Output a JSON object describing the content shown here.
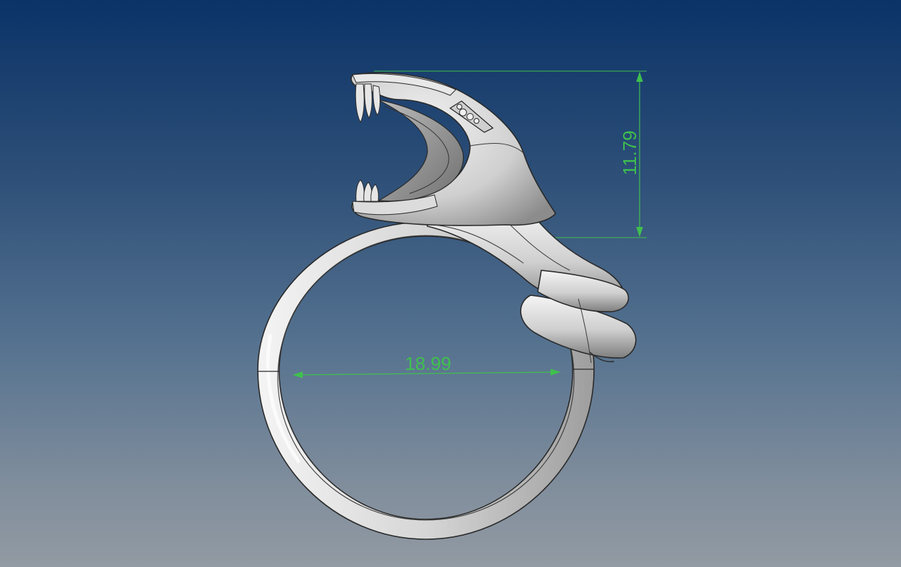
{
  "viewport": {
    "background_top": "#0b3368",
    "background_bottom": "#929aa3",
    "model_color": "#d9d9d9",
    "dimension_color": "#3fc04e"
  },
  "model": {
    "subject": "snake-ring"
  },
  "dimensions": {
    "inner_diameter": "18.99",
    "head_height": "11.79"
  }
}
